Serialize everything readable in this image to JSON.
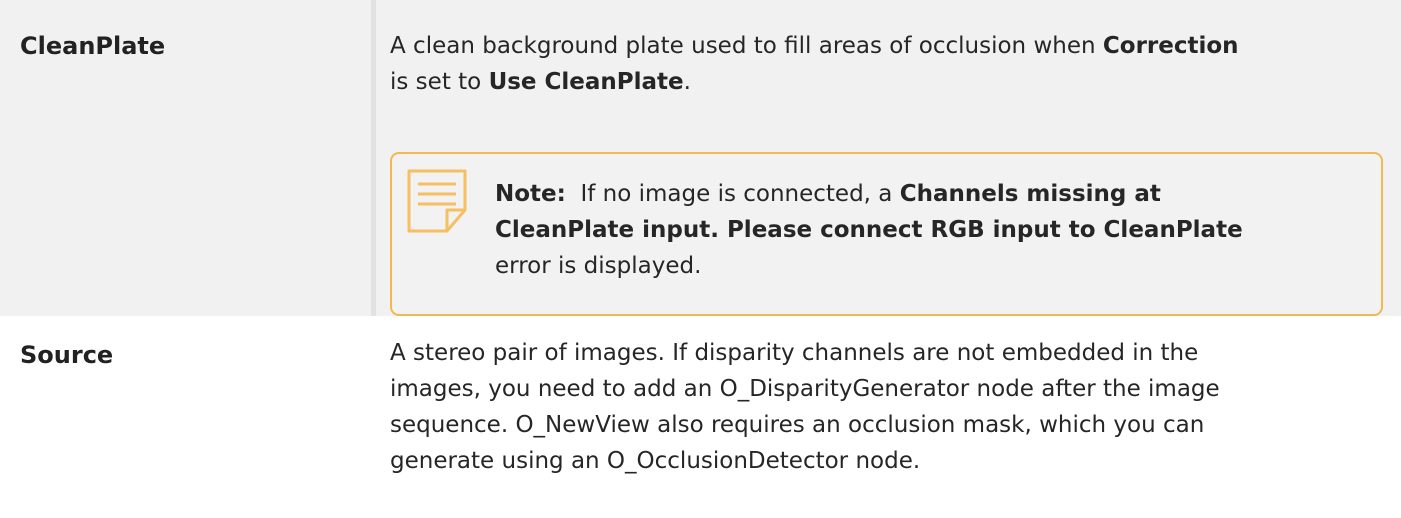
{
  "rows": [
    {
      "name": "CleanPlate",
      "description": {
        "line1_text1": "A clean background plate used to fill areas of occlusion when ",
        "line1_bold1": "Correction",
        "line2_text1": "is set to ",
        "line2_bold1": "Use CleanPlate",
        "line2_text2": "."
      },
      "note": {
        "label": "Note:",
        "line1_text1": "  If no image is connected, a ",
        "line1_bold1": "Channels missing at",
        "line2_bold1": "CleanPlate input. Please connect RGB input to CleanPlate",
        "line3_text1": "error is displayed.",
        "icon": "note-icon",
        "accent_color": "#f3b950"
      }
    },
    {
      "name": "Source",
      "description": {
        "line1": "A stereo pair of images. If disparity channels are not embedded in the",
        "line2": "images, you need to add an O_DisparityGenerator node after the image",
        "line3": "sequence. O_NewView also requires an occlusion mask, which you can",
        "line4": "generate using an O_OcclusionDetector node."
      }
    }
  ]
}
